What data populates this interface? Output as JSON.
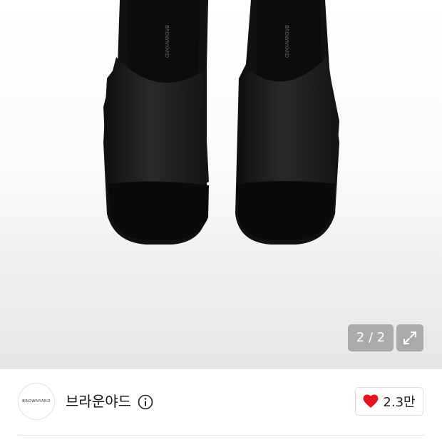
{
  "gallery": {
    "image": "black-leather-slide-sandals",
    "counter": "2 / 2",
    "expand_icon": "expand-arrows-icon"
  },
  "brand": {
    "logo_text": "BROWNYARD",
    "name": "브라운야드",
    "info_icon": "info-icon"
  },
  "like": {
    "icon": "heart-icon",
    "color": "#e8121d",
    "count": "2.3만"
  }
}
